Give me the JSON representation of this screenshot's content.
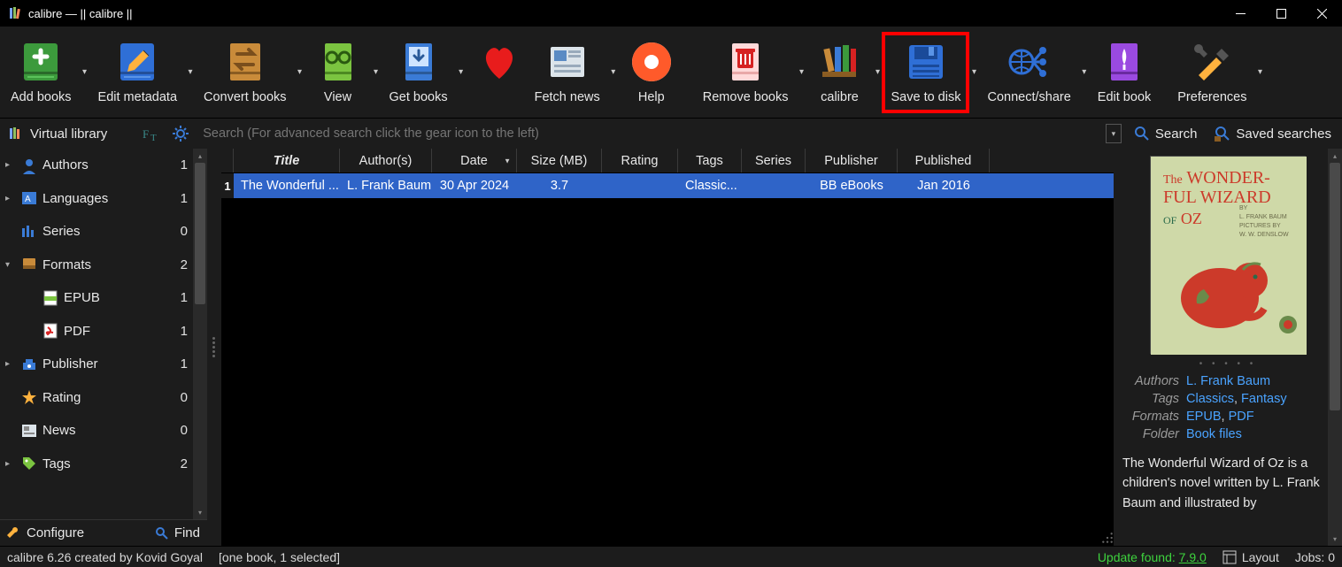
{
  "titlebar": {
    "text": "calibre — || calibre ||"
  },
  "toolbar": [
    {
      "label": "Add books",
      "drop": true
    },
    {
      "label": "Edit metadata",
      "drop": true
    },
    {
      "label": "Convert books",
      "drop": true
    },
    {
      "label": "View",
      "drop": true
    },
    {
      "label": "Get books",
      "drop": true
    },
    {
      "label": "Fetch news",
      "drop": true
    },
    {
      "label": "Help",
      "drop": false
    },
    {
      "label": "Remove books",
      "drop": true
    },
    {
      "label": "calibre",
      "drop": true
    },
    {
      "label": "Save to disk",
      "drop": true,
      "highlight": true
    },
    {
      "label": "Connect/share",
      "drop": true
    },
    {
      "label": "Edit book",
      "drop": false
    },
    {
      "label": "Preferences",
      "drop": true
    }
  ],
  "searchbar": {
    "virtual_library": "Virtual library",
    "placeholder": "Search (For advanced search click the gear icon to the left)",
    "search": "Search",
    "saved": "Saved searches"
  },
  "tree": [
    {
      "label": "Authors",
      "count": "1",
      "icon": "authors",
      "arrow": true,
      "child": false
    },
    {
      "label": "Languages",
      "count": "1",
      "icon": "languages",
      "arrow": true,
      "child": false
    },
    {
      "label": "Series",
      "count": "0",
      "icon": "series",
      "arrow": false,
      "child": false
    },
    {
      "label": "Formats",
      "count": "2",
      "icon": "formats",
      "arrow": true,
      "child": false,
      "expanded": true
    },
    {
      "label": "EPUB",
      "count": "1",
      "icon": "epub-file",
      "arrow": false,
      "child": true
    },
    {
      "label": "PDF",
      "count": "1",
      "icon": "pdf-file",
      "arrow": false,
      "child": true
    },
    {
      "label": "Publisher",
      "count": "1",
      "icon": "publisher",
      "arrow": true,
      "child": false
    },
    {
      "label": "Rating",
      "count": "0",
      "icon": "rating",
      "arrow": false,
      "child": false
    },
    {
      "label": "News",
      "count": "0",
      "icon": "news",
      "arrow": false,
      "child": false
    },
    {
      "label": "Tags",
      "count": "2",
      "icon": "tags",
      "arrow": true,
      "child": false
    }
  ],
  "sidebar_bottom": {
    "configure": "Configure",
    "find": "Find"
  },
  "grid": {
    "headers": [
      "Title",
      "Author(s)",
      "Date",
      "Size (MB)",
      "Rating",
      "Tags",
      "Series",
      "Publisher",
      "Published"
    ],
    "row": {
      "num": "1",
      "title": "The Wonderful ...",
      "author": "L. Frank Baum",
      "date": "30 Apr 2024",
      "size": "3.7",
      "rating": "",
      "tags": "Classic...",
      "series": "",
      "publisher": "BB eBooks",
      "published": "Jan 2016"
    }
  },
  "details": {
    "cover_title1": "The WONDER-",
    "cover_title2": "FUL WIZARD",
    "cover_title3": "OF OZ",
    "cover_by": "BY",
    "cover_author": "L. FRANK BAUM",
    "cover_pictures": "PICTURES BY",
    "cover_illus": "W. W. DENSLOW",
    "authors_label": "Authors",
    "authors": "L. Frank Baum",
    "tags_label": "Tags",
    "tag1": "Classics",
    "tag2": "Fantasy",
    "formats_label": "Formats",
    "fmt1": "EPUB",
    "fmt2": "PDF",
    "folder_label": "Folder",
    "folder": "Book files",
    "desc": "The Wonderful Wizard of Oz is a children's novel written by L. Frank Baum and illustrated by"
  },
  "status": {
    "credit": "calibre 6.26 created by Kovid Goyal",
    "selection": "[one book, 1 selected]",
    "update_prefix": "Update found:",
    "update_ver": "7.9.0",
    "layout": "Layout",
    "jobs": "Jobs: 0"
  }
}
